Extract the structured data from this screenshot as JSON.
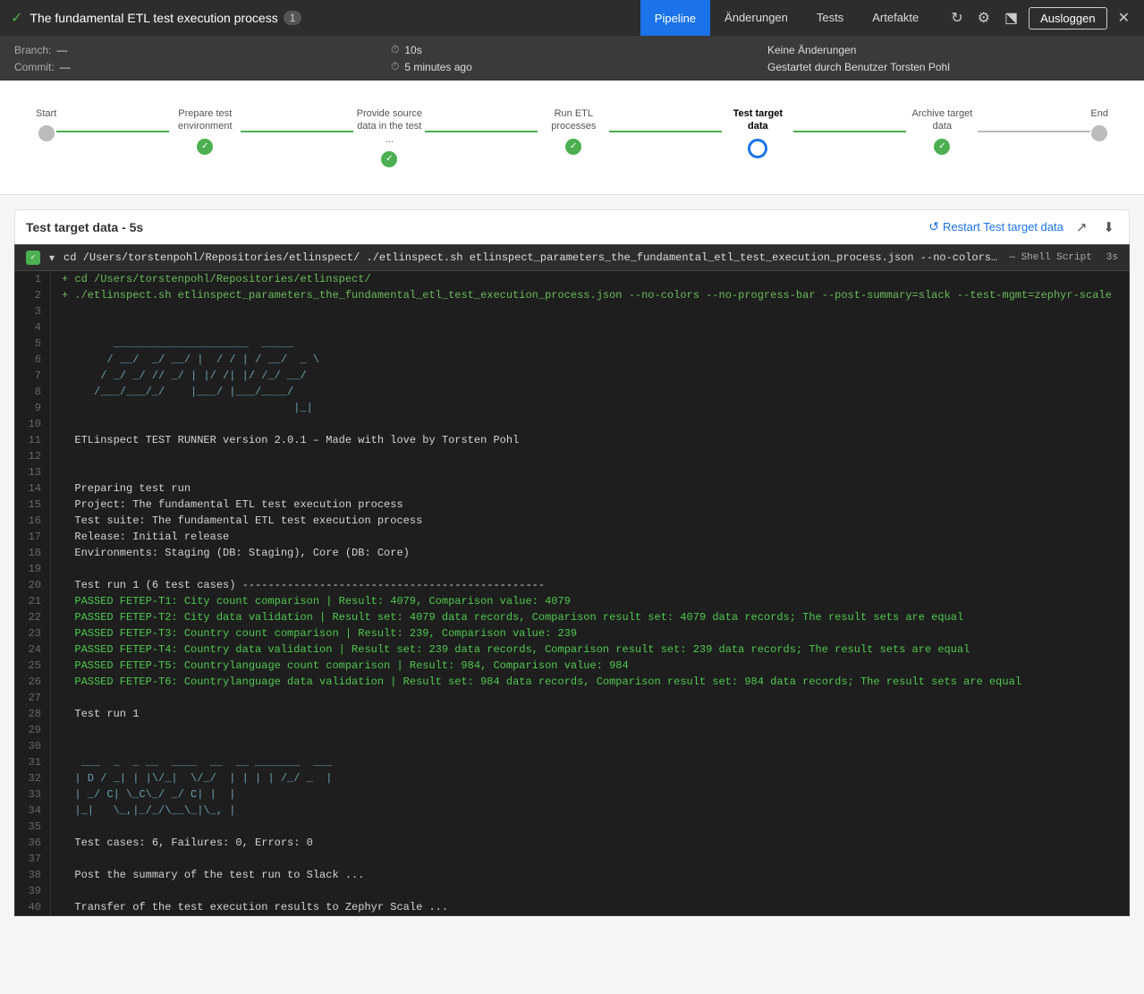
{
  "header": {
    "check_icon": "✓",
    "title": "The fundamental ETL test execution process",
    "build_number": "1",
    "tabs": [
      {
        "label": "Pipeline",
        "active": true
      },
      {
        "label": "Änderungen",
        "active": false
      },
      {
        "label": "Tests",
        "active": false
      },
      {
        "label": "Artefakte",
        "active": false
      }
    ],
    "ausloggen_label": "Ausloggen"
  },
  "meta": {
    "branch_label": "Branch:",
    "branch_value": "—",
    "time_icon": "⏱",
    "time_value": "10s",
    "no_changes": "Keine Änderungen",
    "commit_label": "Commit:",
    "commit_value": "—",
    "relative_time_icon": "⏱",
    "relative_time": "5 minutes ago",
    "started_by": "Gestartet durch Benutzer Torsten Pohl"
  },
  "pipeline": {
    "steps": [
      {
        "id": "start",
        "label": "Start",
        "status": "inactive",
        "connector_after": "done"
      },
      {
        "id": "prepare",
        "label": "Prepare test environment",
        "status": "done",
        "connector_after": "done"
      },
      {
        "id": "provide",
        "label": "Provide source data in the test ...",
        "status": "done",
        "connector_after": "done"
      },
      {
        "id": "run",
        "label": "Run ETL processes",
        "status": "done",
        "connector_after": "done"
      },
      {
        "id": "test",
        "label": "Test target data",
        "status": "active",
        "connector_after": "done"
      },
      {
        "id": "archive",
        "label": "Archive target data",
        "status": "done",
        "connector_after": "inactive"
      },
      {
        "id": "end",
        "label": "End",
        "status": "inactive",
        "connector_after": null
      }
    ]
  },
  "section": {
    "title": "Test target data - 5s",
    "restart_label": "Restart Test target data",
    "cmd": "cd /Users/torstenpohl/Repositories/etlinspect/  ./etlinspect.sh etlinspect_parameters_the_fundamental_etl_test_execution_process.json --no-colors --no-progress-b...",
    "cmd_tag": "— Shell Script",
    "cmd_time": "3s"
  },
  "terminal": {
    "lines": [
      {
        "num": 1,
        "content": "+ cd /Users/torstenpohl/Repositories/etlinspect/",
        "style": "green"
      },
      {
        "num": 2,
        "content": "+ ./etlinspect.sh etlinspect_parameters_the_fundamental_etl_test_execution_process.json --no-colors --no-progress-bar --post-summary=slack --test-mgmt=zephyr-scale",
        "style": "green"
      },
      {
        "num": 3,
        "content": "",
        "style": ""
      },
      {
        "num": 4,
        "content": "",
        "style": ""
      },
      {
        "num": 5,
        "content": "        _____________________  _____",
        "style": "ascii"
      },
      {
        "num": 6,
        "content": "       / __/  _/ __/ |  / / | / __/  _ \\",
        "style": "ascii"
      },
      {
        "num": 7,
        "content": "      / _/ _/ // _/ | |/ /| |/ /_/ __/",
        "style": "ascii"
      },
      {
        "num": 8,
        "content": "     /___/___/_/    |___/ |___/____/",
        "style": "ascii"
      },
      {
        "num": 9,
        "content": "                                    |_|",
        "style": "ascii"
      },
      {
        "num": 10,
        "content": "",
        "style": ""
      },
      {
        "num": 11,
        "content": "  ETLinspect TEST RUNNER version 2.0.1 – Made with love by Torsten Pohl",
        "style": ""
      },
      {
        "num": 12,
        "content": "",
        "style": ""
      },
      {
        "num": 13,
        "content": "",
        "style": ""
      },
      {
        "num": 14,
        "content": "  Preparing test run",
        "style": ""
      },
      {
        "num": 15,
        "content": "  Project: The fundamental ETL test execution process",
        "style": ""
      },
      {
        "num": 16,
        "content": "  Test suite: The fundamental ETL test execution process",
        "style": ""
      },
      {
        "num": 17,
        "content": "  Release: Initial release",
        "style": ""
      },
      {
        "num": 18,
        "content": "  Environments: Staging (DB: Staging), Core (DB: Core)",
        "style": ""
      },
      {
        "num": 19,
        "content": "",
        "style": ""
      },
      {
        "num": 20,
        "content": "  Test run 1 (6 test cases) -----------------------------------------------",
        "style": ""
      },
      {
        "num": 21,
        "content": "  PASSED FETEP-T1: City count comparison | Result: 4079, Comparison value: 4079",
        "style": "passed"
      },
      {
        "num": 22,
        "content": "  PASSED FETEP-T2: City data validation | Result set: 4079 data records, Comparison result set: 4079 data records; The result sets are equal",
        "style": "passed"
      },
      {
        "num": 23,
        "content": "  PASSED FETEP-T3: Country count comparison | Result: 239, Comparison value: 239",
        "style": "passed"
      },
      {
        "num": 24,
        "content": "  PASSED FETEP-T4: Country data validation | Result set: 239 data records, Comparison result set: 239 data records; The result sets are equal",
        "style": "passed"
      },
      {
        "num": 25,
        "content": "  PASSED FETEP-T5: Countrylanguage count comparison | Result: 984, Comparison value: 984",
        "style": "passed"
      },
      {
        "num": 26,
        "content": "  PASSED FETEP-T6: Countrylanguage data validation | Result set: 984 data records, Comparison result set: 984 data records; The result sets are equal",
        "style": "passed"
      },
      {
        "num": 27,
        "content": "",
        "style": ""
      },
      {
        "num": 28,
        "content": "  Test run 1",
        "style": ""
      },
      {
        "num": 29,
        "content": "",
        "style": ""
      },
      {
        "num": 30,
        "content": "",
        "style": ""
      },
      {
        "num": 31,
        "content": "   ___  _  _ __  ____  __  __ _______  ___",
        "style": "ascii"
      },
      {
        "num": 32,
        "content": "  | D / _| | |\\/_|  \\/_/  | | | | /_/ _  |",
        "style": "ascii"
      },
      {
        "num": 33,
        "content": "  | _/ C| \\_C\\_/ _/ C| |  |",
        "style": "ascii"
      },
      {
        "num": 34,
        "content": "  |_|   \\_,|_/_/\\__\\_|\\_, |",
        "style": "ascii"
      },
      {
        "num": 35,
        "content": "",
        "style": ""
      },
      {
        "num": 36,
        "content": "  Test cases: 6, Failures: 0, Errors: 0",
        "style": ""
      },
      {
        "num": 37,
        "content": "",
        "style": ""
      },
      {
        "num": 38,
        "content": "  Post the summary of the test run to Slack ...",
        "style": ""
      },
      {
        "num": 39,
        "content": "",
        "style": ""
      },
      {
        "num": 40,
        "content": "  Transfer of the test execution results to Zephyr Scale ...",
        "style": ""
      }
    ]
  }
}
